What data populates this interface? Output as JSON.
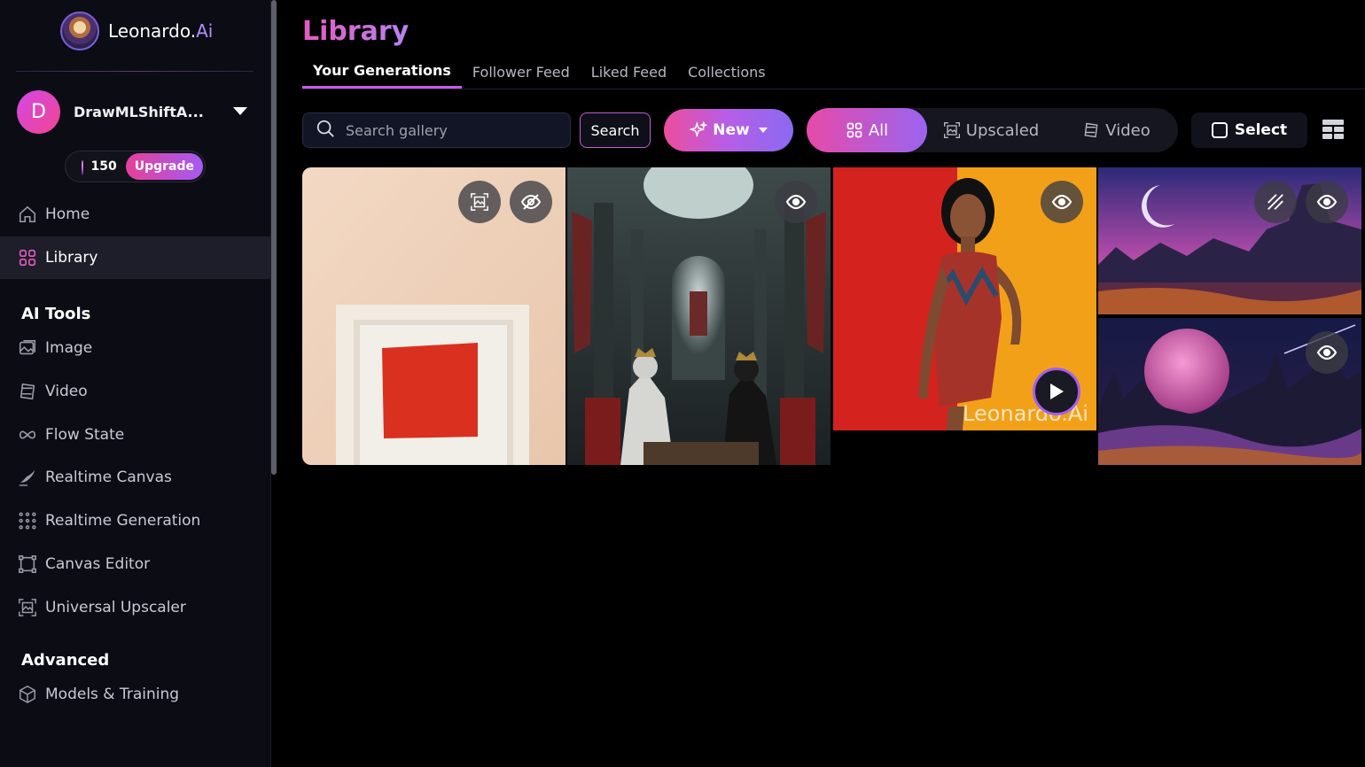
{
  "brand": {
    "name": "Leonardo.",
    "name_suffix": "Ai"
  },
  "user": {
    "initial": "D",
    "name": "DrawMLShiftA..."
  },
  "credits": {
    "value": "150",
    "upgrade_label": "Upgrade"
  },
  "nav": {
    "home": "Home",
    "library": "Library"
  },
  "ai_tools": {
    "title": "AI Tools",
    "items": [
      "Image",
      "Video",
      "Flow State",
      "Realtime Canvas",
      "Realtime Generation",
      "Canvas Editor",
      "Universal Upscaler"
    ]
  },
  "advanced": {
    "title": "Advanced",
    "items": [
      "Models & Training"
    ]
  },
  "page": {
    "title": "Library",
    "tabs": [
      "Your Generations",
      "Follower Feed",
      "Liked Feed",
      "Collections"
    ],
    "active_tab": "Your Generations"
  },
  "toolbar": {
    "search_placeholder": "Search gallery",
    "search_label": "Search",
    "new_label": "New",
    "filters": [
      "All",
      "Upscaled",
      "Video"
    ],
    "active_filter": "All",
    "select_label": "Select"
  },
  "gallery": {
    "watermark": "Leonardo.Ai"
  },
  "colors": {
    "accent_pink": "#e64aa8",
    "accent_purple": "#9b64f0",
    "sidebar_bg": "#0b0c14"
  }
}
